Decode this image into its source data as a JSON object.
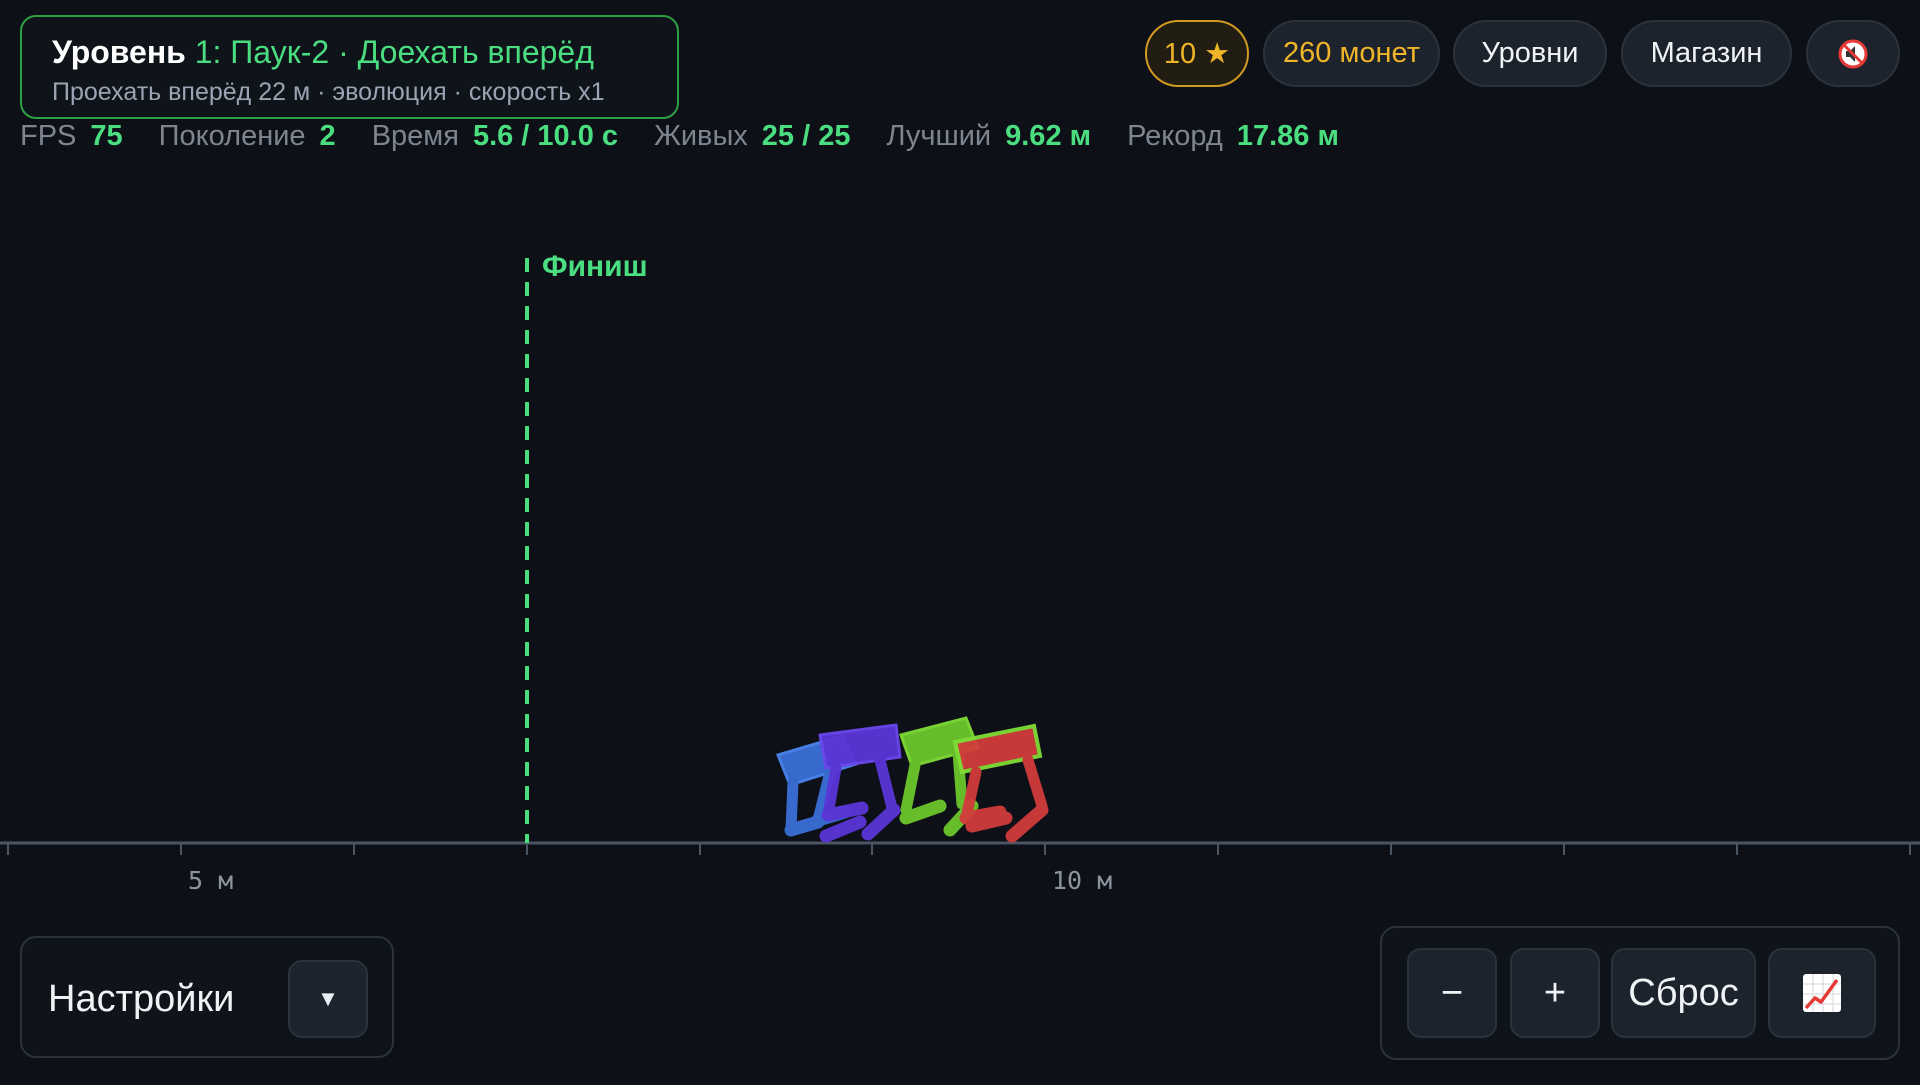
{
  "level": {
    "prefix": "Уровень",
    "number": "1:",
    "name": "Паук-2 · Доехать вперёд",
    "subtitle": "Проехать вперёд 22 м · эволюция · скорость x1"
  },
  "header": {
    "stars": "10 ★",
    "coins": "260 монет",
    "levels_label": "Уровни",
    "shop_label": "Магазин",
    "sound_icon": "mute-icon"
  },
  "stats": {
    "fps_label": "FPS",
    "fps": "75",
    "generation_label": "Поколение",
    "generation": "2",
    "time_label": "Время",
    "time": "5.6 / 10.0 с",
    "alive_label": "Живых",
    "alive": "25 / 25",
    "best_label": "Лучший",
    "best": "9.62 м",
    "record_label": "Рекорд",
    "record": "17.86 м"
  },
  "world": {
    "finish_label": "Финиш",
    "axis_labels": [
      "5 м",
      "10 м"
    ],
    "creature_colors": [
      "#3b6fd8",
      "#5a35d6",
      "#6cc72a",
      "#d23b3b"
    ]
  },
  "settings": {
    "label": "Настройки",
    "toggle_icon": "▼"
  },
  "controls": {
    "minus": "−",
    "plus": "+",
    "reset": "Сброс",
    "chart_icon": "chart-icon"
  }
}
